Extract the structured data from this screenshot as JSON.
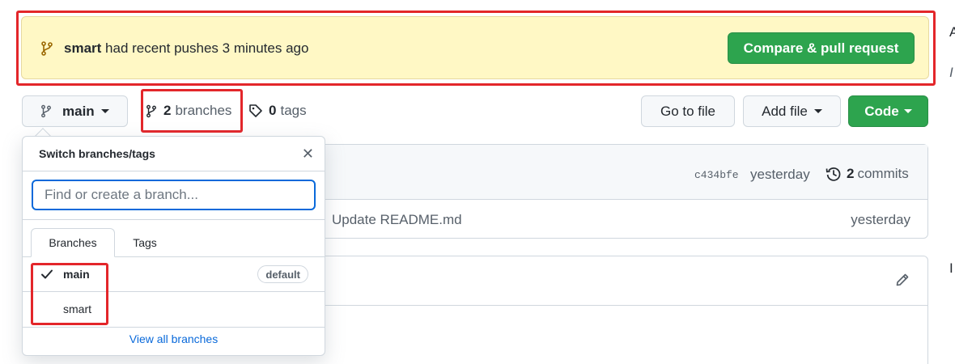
{
  "banner": {
    "branch": "smart",
    "message": "had recent pushes 3 minutes ago",
    "compare_button": "Compare & pull request"
  },
  "toolbar": {
    "branch_button": "main",
    "branches_count": "2",
    "branches_label": "branches",
    "tags_count": "0",
    "tags_label": "tags",
    "go_to_file": "Go to file",
    "add_file": "Add file",
    "code": "Code"
  },
  "commit_bar": {
    "sha": "c434bfe",
    "time": "yesterday",
    "commits_count": "2",
    "commits_label": "commits"
  },
  "file_row": {
    "message": "Update README.md",
    "time": "yesterday"
  },
  "dropdown": {
    "title": "Switch branches/tags",
    "search_placeholder": "Find or create a branch...",
    "tabs": [
      "Branches",
      "Tags"
    ],
    "branches": [
      {
        "name": "main",
        "badge": "default",
        "selected": true
      },
      {
        "name": "smart",
        "badge": "",
        "selected": false
      }
    ],
    "view_all": "View all branches"
  },
  "colors": {
    "accent_green": "#2da44e",
    "banner_bg": "#fff8c5",
    "link_blue": "#0969da",
    "annotation_red": "#e3262a"
  }
}
